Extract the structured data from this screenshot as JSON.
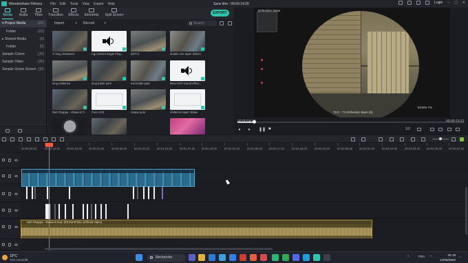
{
  "titlebar": {
    "app_name": "Wondershare Filmora",
    "menus": [
      "File",
      "Edit",
      "Tools",
      "View",
      "Export",
      "Help"
    ],
    "center_title": "Sans titre : 00:03:14:20",
    "login_label": "Login"
  },
  "toolbar": {
    "tabs": [
      {
        "label": "Media",
        "active": true
      },
      {
        "label": "Audio",
        "active": false
      },
      {
        "label": "Titles",
        "active": false
      },
      {
        "label": "Transition",
        "active": false
      },
      {
        "label": "Effects",
        "active": false
      },
      {
        "label": "Elements",
        "active": false
      },
      {
        "label": "Split Screen",
        "active": false
      }
    ],
    "export_label": "EXPORT"
  },
  "folders": [
    {
      "label": "▾ Project Media",
      "count": "(21)",
      "selected": true
    },
    {
      "label": "Folder",
      "count": "(21)",
      "selected": false
    },
    {
      "label": "▸ Shared Media",
      "count": "(0)",
      "selected": false
    },
    {
      "label": "Folder",
      "count": "(0)",
      "selected": false
    },
    {
      "label": "Sample Colors",
      "count": "(15)",
      "selected": false
    },
    {
      "label": "Sample Video",
      "count": "(20)",
      "selected": false
    },
    {
      "label": "Sample Green Screen",
      "count": "(10)",
      "selected": false
    }
  ],
  "media_bar": {
    "import_label": "Import",
    "record_label": "Record",
    "search_placeholder": "Search"
  },
  "media_items": [
    {
      "caption": "-k long résistence",
      "style": "fps"
    },
    {
      "caption": "Cgo Desert Eagle Ping...",
      "style": "speaker"
    },
    {
      "caption": "dt2T-3",
      "style": "fps2"
    },
    {
      "caption": "double one taper district",
      "style": "fps3"
    },
    {
      "caption": "long résitence",
      "style": "fps2"
    },
    {
      "caption": "long trailer park",
      "style": "fps"
    },
    {
      "caption": "mid trailer park",
      "style": "fps3"
    },
    {
      "caption": "New mVF sound effect...",
      "style": "speaker"
    },
    {
      "caption": "Niel Ghappa - Shaka B T...",
      "style": "fps"
    },
    {
      "caption": "Pure ACE",
      "style": "white"
    },
    {
      "caption": "rampe pure",
      "style": "fps2"
    },
    {
      "caption": "résitence taper shake",
      "style": "white"
    },
    {
      "caption": "",
      "style": "scope"
    },
    {
      "caption": "",
      "style": "fps"
    },
    {
      "caption": "",
      "style": "tiktok"
    },
    {
      "caption": "",
      "style": "pink"
    }
  ],
  "preview": {
    "hud_name": "Defenders Base",
    "hud_bottom": "75:0 : 7:9   Défendez Base (0)",
    "hud_right": "Entrée 7%",
    "time_left": "00:00:04:09",
    "time_right": "00:00:13:21",
    "ratio": "1/2",
    "progress_fraction": 0.073
  },
  "ruler": {
    "ticks": [
      "00:00:00:00",
      "00:00:12:20",
      "00:00:25:00",
      "00:00:37:20",
      "00:00:50:00",
      "00:01:02:20",
      "00:01:15:00",
      "00:01:27:20",
      "00:01:40:00",
      "00:01:52:20",
      "00:02:05:00",
      "00:02:17:20",
      "00:02:30:00",
      "00:02:42:20",
      "00:02:55:00",
      "00:03:07:20",
      "00:03:20:00",
      "00:03:32:20",
      "00:03:45:00",
      "00:03:57:20"
    ]
  },
  "audio_clip": {
    "label": "Niel Ghappa - Shaka B feat. @RoseHFilmo (Official Video)"
  },
  "taskbar": {
    "temperature": "19°C",
    "weather_text": "Très ensoleillé",
    "search_label": "Recherche",
    "lang": "FRA",
    "time": "22:16",
    "date": "14/05/2023"
  }
}
